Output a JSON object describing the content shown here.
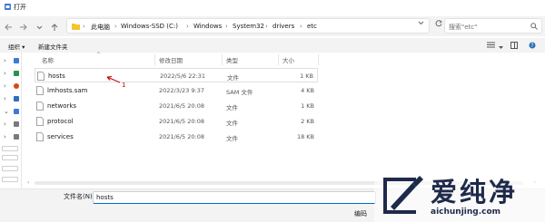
{
  "window": {
    "title": "打开"
  },
  "address": {
    "crumbs": [
      "此电脑",
      "Windows-SSD (C:)",
      "Windows",
      "System32",
      "drivers",
      "etc"
    ],
    "separator": "›"
  },
  "search": {
    "placeholder": "搜索\"etc\""
  },
  "toolbar": {
    "organize_label": "组织 ▾",
    "new_folder_label": "新建文件夹"
  },
  "columns": {
    "name": "名称",
    "modified": "修改日期",
    "type": "类型",
    "size": "大小"
  },
  "files": [
    {
      "name": "hosts",
      "modified": "2022/5/6 22:31",
      "type": "文件",
      "size": "1 KB",
      "selected": true
    },
    {
      "name": "lmhosts.sam",
      "modified": "2022/3/23 9:37",
      "type": "SAM 文件",
      "size": "4 KB"
    },
    {
      "name": "networks",
      "modified": "2021/6/5 20:08",
      "type": "文件",
      "size": "1 KB"
    },
    {
      "name": "protocol",
      "modified": "2021/6/5 20:08",
      "type": "文件",
      "size": "2 KB"
    },
    {
      "name": "services",
      "modified": "2021/6/5 20:08",
      "type": "文件",
      "size": "18 KB"
    }
  ],
  "annotation": {
    "marker": "1",
    "color": "#c00000"
  },
  "bottom": {
    "filename_label": "文件名(N):",
    "filename_value": "hosts",
    "encoding_label": "编码"
  },
  "watermark": {
    "chinese": "爱纯净",
    "url": "aichunjing.com"
  },
  "colors": {
    "accent": "#0067c0",
    "folder": "#f4c430"
  }
}
